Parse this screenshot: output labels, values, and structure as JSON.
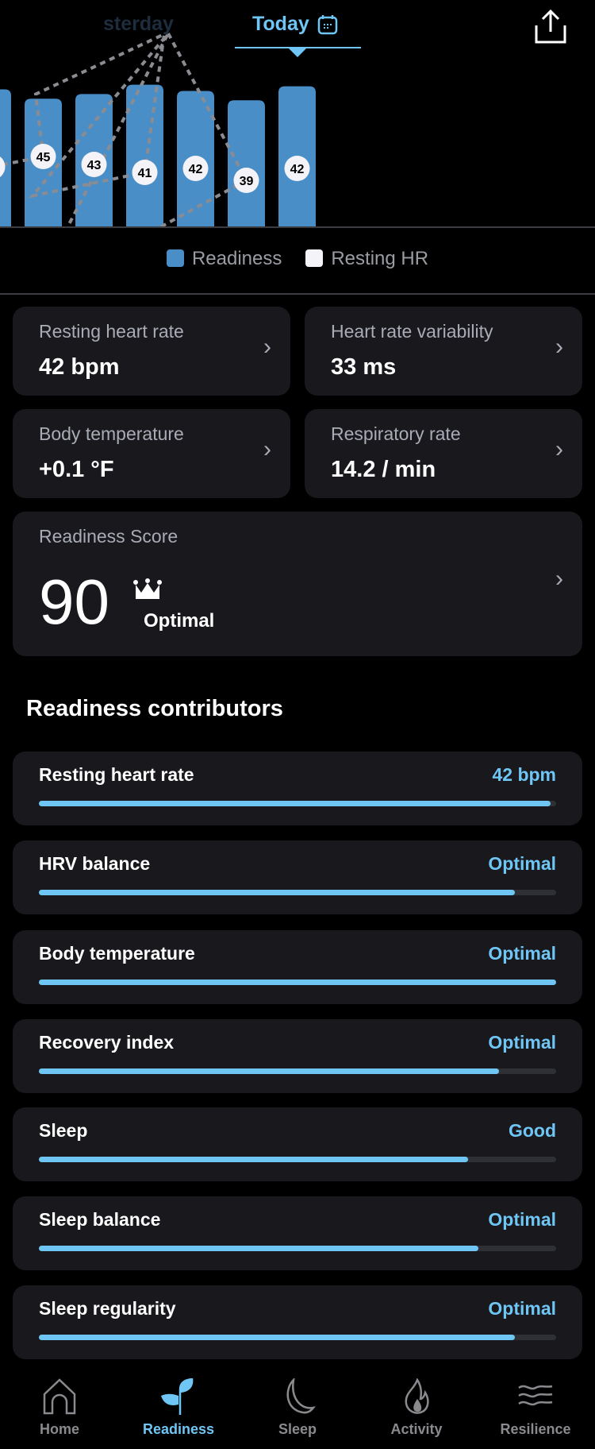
{
  "header": {
    "tab_prev": "sterday",
    "tab_current": "Today",
    "share_icon": "share-icon",
    "calendar_icon": "calendar-icon"
  },
  "chart_data": {
    "type": "bar",
    "series": [
      {
        "name": "Readiness",
        "values": [
          88,
          82,
          85,
          91,
          87,
          81,
          90
        ],
        "color": "#4a8ec8"
      },
      {
        "name": "Resting HR",
        "values": [
          null,
          45,
          43,
          41,
          42,
          39,
          42
        ],
        "color": "#f4f4f8"
      }
    ]
  },
  "legend": {
    "readiness": "Readiness",
    "resting_hr": "Resting HR"
  },
  "metrics": [
    {
      "label": "Resting heart rate",
      "value": "42 bpm"
    },
    {
      "label": "Heart rate variability",
      "value": "33 ms"
    },
    {
      "label": "Body temperature",
      "value": "+0.1 °F"
    },
    {
      "label": "Respiratory rate",
      "value": "14.2 / min"
    }
  ],
  "score": {
    "label": "Readiness Score",
    "value": "90",
    "status": "Optimal",
    "icon": "crown-icon"
  },
  "contributors_title": "Readiness contributors",
  "contributors": [
    {
      "name": "Resting heart rate",
      "value": "42 bpm",
      "progress": 0.99
    },
    {
      "name": "HRV balance",
      "value": "Optimal",
      "progress": 0.92
    },
    {
      "name": "Body temperature",
      "value": "Optimal",
      "progress": 1.0
    },
    {
      "name": "Recovery index",
      "value": "Optimal",
      "progress": 0.89
    },
    {
      "name": "Sleep",
      "value": "Good",
      "progress": 0.83
    },
    {
      "name": "Sleep balance",
      "value": "Optimal",
      "progress": 0.85
    },
    {
      "name": "Sleep regularity",
      "value": "Optimal",
      "progress": 0.92
    }
  ],
  "nav": [
    {
      "label": "Home",
      "icon": "home-icon"
    },
    {
      "label": "Readiness",
      "icon": "sprout-icon",
      "active": true
    },
    {
      "label": "Sleep",
      "icon": "moon-icon"
    },
    {
      "label": "Activity",
      "icon": "flame-icon"
    },
    {
      "label": "Resilience",
      "icon": "waves-icon"
    }
  ]
}
